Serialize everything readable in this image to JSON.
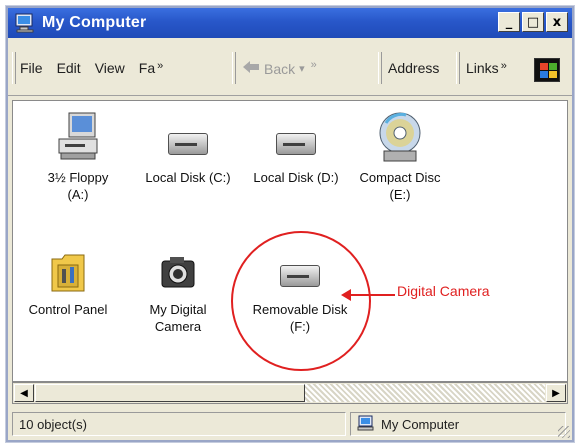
{
  "window": {
    "title": "My Computer",
    "controls": {
      "minimize": "_",
      "maximize": "□",
      "close": "x"
    }
  },
  "toolbar": {
    "menu": [
      "File",
      "Edit",
      "View",
      "Fa"
    ],
    "menu_more": "»",
    "back_label": "Back",
    "back_dropdown": "▾",
    "address_label": "Address",
    "links_label": "Links",
    "links_more": "»"
  },
  "items": [
    {
      "label": "3½ Floppy\n(A:)",
      "icon": "floppy-drive-icon"
    },
    {
      "label": "Local Disk (C:)",
      "icon": "hard-disk-icon"
    },
    {
      "label": "Local Disk (D:)",
      "icon": "hard-disk-icon"
    },
    {
      "label": "Compact Disc\n(E:)",
      "icon": "cd-drive-icon"
    },
    {
      "label": "Control Panel",
      "icon": "control-panel-icon"
    },
    {
      "label": "My Digital\nCamera",
      "icon": "camera-icon"
    },
    {
      "label": "Removable Disk\n(F:)",
      "icon": "removable-disk-icon"
    }
  ],
  "annotation": {
    "text": "Digital Camera",
    "color": "#e02020"
  },
  "status": {
    "objects": "10 object(s)",
    "location": "My Computer"
  },
  "colors": {
    "titlebar": "#2857c9",
    "chrome": "#ece9d8",
    "annotation": "#e02020"
  }
}
